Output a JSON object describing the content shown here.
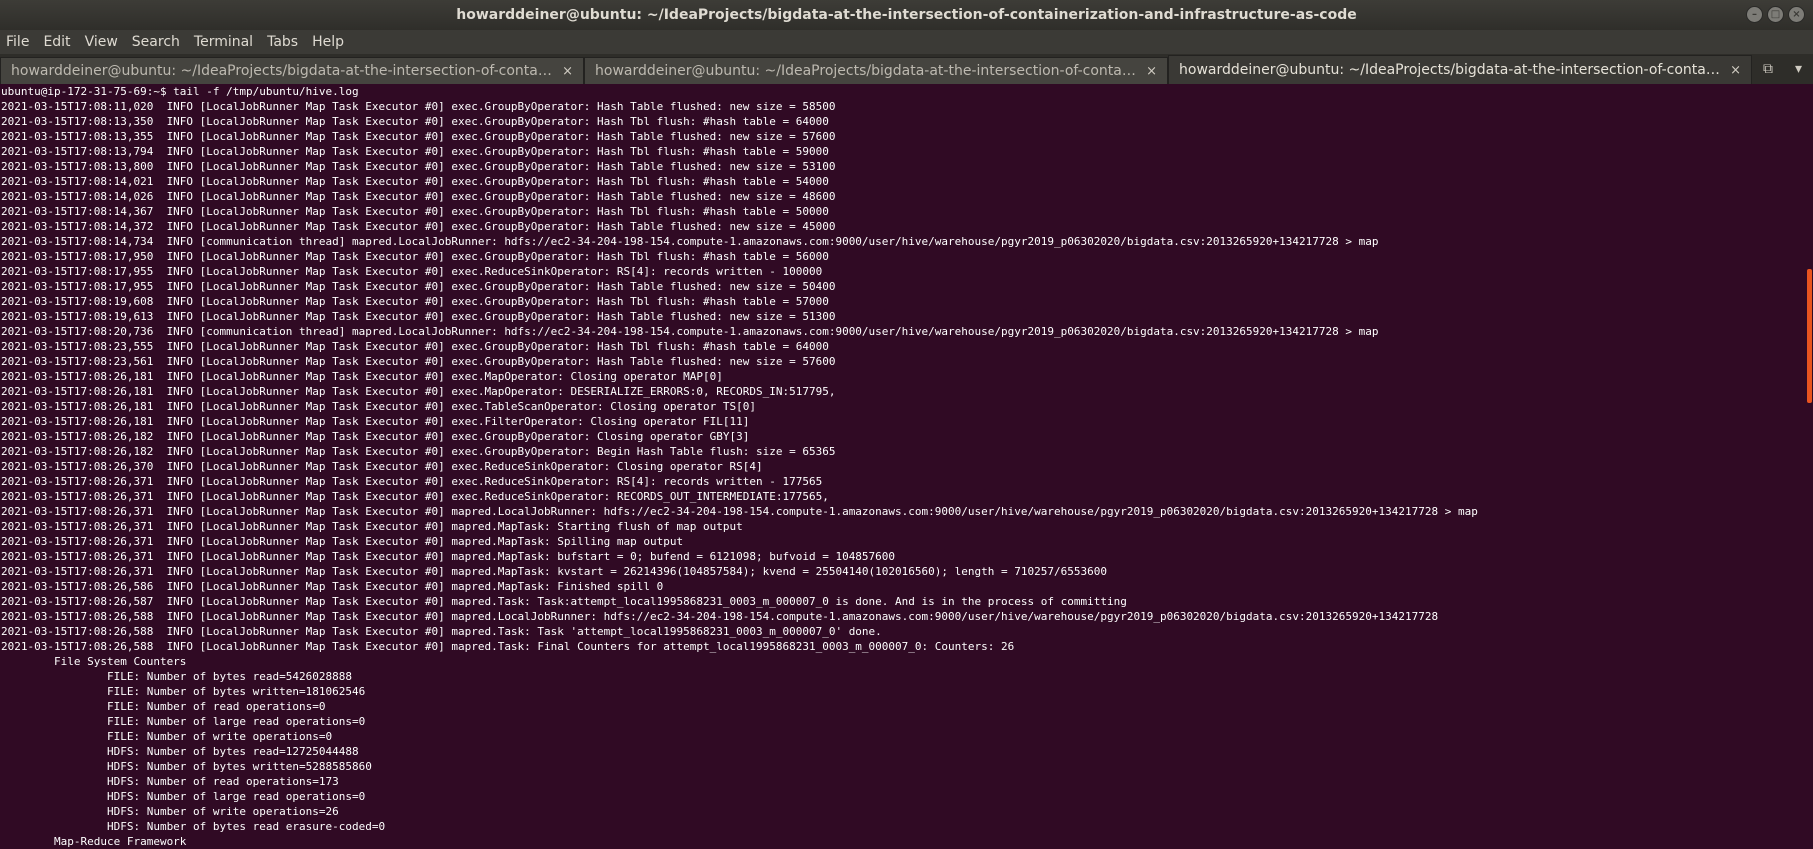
{
  "window": {
    "title": "howarddeiner@ubuntu: ~/IdeaProjects/bigdata-at-the-intersection-of-containerization-and-infrastructure-as-code",
    "controls": {
      "minimize": "–",
      "maximize": "□",
      "close": "×"
    }
  },
  "menu": {
    "file": "File",
    "edit": "Edit",
    "view": "View",
    "search": "Search",
    "terminal": "Terminal",
    "tabs": "Tabs",
    "help": "Help"
  },
  "tabs": [
    {
      "label": "howarddeiner@ubuntu: ~/IdeaProjects/bigdata-at-the-intersection-of-containe...",
      "close": "×"
    },
    {
      "label": "howarddeiner@ubuntu: ~/IdeaProjects/bigdata-at-the-intersection-of-containe...",
      "close": "×"
    },
    {
      "label": "howarddeiner@ubuntu: ~/IdeaProjects/bigdata-at-the-intersection-of-containe...",
      "close": "×"
    }
  ],
  "tab_tools": {
    "new_tab_icon": "⧉",
    "dropdown_icon": "▾"
  },
  "terminal": {
    "lines": [
      "ubuntu@ip-172-31-75-69:~$ tail -f /tmp/ubuntu/hive.log",
      "2021-03-15T17:08:11,020  INFO [LocalJobRunner Map Task Executor #0] exec.GroupByOperator: Hash Table flushed: new size = 58500",
      "2021-03-15T17:08:13,350  INFO [LocalJobRunner Map Task Executor #0] exec.GroupByOperator: Hash Tbl flush: #hash table = 64000",
      "2021-03-15T17:08:13,355  INFO [LocalJobRunner Map Task Executor #0] exec.GroupByOperator: Hash Table flushed: new size = 57600",
      "2021-03-15T17:08:13,794  INFO [LocalJobRunner Map Task Executor #0] exec.GroupByOperator: Hash Tbl flush: #hash table = 59000",
      "2021-03-15T17:08:13,800  INFO [LocalJobRunner Map Task Executor #0] exec.GroupByOperator: Hash Table flushed: new size = 53100",
      "2021-03-15T17:08:14,021  INFO [LocalJobRunner Map Task Executor #0] exec.GroupByOperator: Hash Tbl flush: #hash table = 54000",
      "2021-03-15T17:08:14,026  INFO [LocalJobRunner Map Task Executor #0] exec.GroupByOperator: Hash Table flushed: new size = 48600",
      "2021-03-15T17:08:14,367  INFO [LocalJobRunner Map Task Executor #0] exec.GroupByOperator: Hash Tbl flush: #hash table = 50000",
      "2021-03-15T17:08:14,372  INFO [LocalJobRunner Map Task Executor #0] exec.GroupByOperator: Hash Table flushed: new size = 45000",
      "2021-03-15T17:08:14,734  INFO [communication thread] mapred.LocalJobRunner: hdfs://ec2-34-204-198-154.compute-1.amazonaws.com:9000/user/hive/warehouse/pgyr2019_p06302020/bigdata.csv:2013265920+134217728 > map",
      "2021-03-15T17:08:17,950  INFO [LocalJobRunner Map Task Executor #0] exec.GroupByOperator: Hash Tbl flush: #hash table = 56000",
      "2021-03-15T17:08:17,955  INFO [LocalJobRunner Map Task Executor #0] exec.ReduceSinkOperator: RS[4]: records written - 100000",
      "2021-03-15T17:08:17,955  INFO [LocalJobRunner Map Task Executor #0] exec.GroupByOperator: Hash Table flushed: new size = 50400",
      "2021-03-15T17:08:19,608  INFO [LocalJobRunner Map Task Executor #0] exec.GroupByOperator: Hash Tbl flush: #hash table = 57000",
      "2021-03-15T17:08:19,613  INFO [LocalJobRunner Map Task Executor #0] exec.GroupByOperator: Hash Table flushed: new size = 51300",
      "2021-03-15T17:08:20,736  INFO [communication thread] mapred.LocalJobRunner: hdfs://ec2-34-204-198-154.compute-1.amazonaws.com:9000/user/hive/warehouse/pgyr2019_p06302020/bigdata.csv:2013265920+134217728 > map",
      "2021-03-15T17:08:23,555  INFO [LocalJobRunner Map Task Executor #0] exec.GroupByOperator: Hash Tbl flush: #hash table = 64000",
      "2021-03-15T17:08:23,561  INFO [LocalJobRunner Map Task Executor #0] exec.GroupByOperator: Hash Table flushed: new size = 57600",
      "2021-03-15T17:08:26,181  INFO [LocalJobRunner Map Task Executor #0] exec.MapOperator: Closing operator MAP[0]",
      "2021-03-15T17:08:26,181  INFO [LocalJobRunner Map Task Executor #0] exec.MapOperator: DESERIALIZE_ERRORS:0, RECORDS_IN:517795,",
      "2021-03-15T17:08:26,181  INFO [LocalJobRunner Map Task Executor #0] exec.TableScanOperator: Closing operator TS[0]",
      "2021-03-15T17:08:26,181  INFO [LocalJobRunner Map Task Executor #0] exec.FilterOperator: Closing operator FIL[11]",
      "2021-03-15T17:08:26,182  INFO [LocalJobRunner Map Task Executor #0] exec.GroupByOperator: Closing operator GBY[3]",
      "2021-03-15T17:08:26,182  INFO [LocalJobRunner Map Task Executor #0] exec.GroupByOperator: Begin Hash Table flush: size = 65365",
      "2021-03-15T17:08:26,370  INFO [LocalJobRunner Map Task Executor #0] exec.ReduceSinkOperator: Closing operator RS[4]",
      "2021-03-15T17:08:26,371  INFO [LocalJobRunner Map Task Executor #0] exec.ReduceSinkOperator: RS[4]: records written - 177565",
      "2021-03-15T17:08:26,371  INFO [LocalJobRunner Map Task Executor #0] exec.ReduceSinkOperator: RECORDS_OUT_INTERMEDIATE:177565,",
      "2021-03-15T17:08:26,371  INFO [LocalJobRunner Map Task Executor #0] mapred.LocalJobRunner: hdfs://ec2-34-204-198-154.compute-1.amazonaws.com:9000/user/hive/warehouse/pgyr2019_p06302020/bigdata.csv:2013265920+134217728 > map",
      "2021-03-15T17:08:26,371  INFO [LocalJobRunner Map Task Executor #0] mapred.MapTask: Starting flush of map output",
      "2021-03-15T17:08:26,371  INFO [LocalJobRunner Map Task Executor #0] mapred.MapTask: Spilling map output",
      "2021-03-15T17:08:26,371  INFO [LocalJobRunner Map Task Executor #0] mapred.MapTask: bufstart = 0; bufend = 6121098; bufvoid = 104857600",
      "2021-03-15T17:08:26,371  INFO [LocalJobRunner Map Task Executor #0] mapred.MapTask: kvstart = 26214396(104857584); kvend = 25504140(102016560); length = 710257/6553600",
      "2021-03-15T17:08:26,586  INFO [LocalJobRunner Map Task Executor #0] mapred.MapTask: Finished spill 0",
      "2021-03-15T17:08:26,587  INFO [LocalJobRunner Map Task Executor #0] mapred.Task: Task:attempt_local1995868231_0003_m_000007_0 is done. And is in the process of committing",
      "2021-03-15T17:08:26,588  INFO [LocalJobRunner Map Task Executor #0] mapred.LocalJobRunner: hdfs://ec2-34-204-198-154.compute-1.amazonaws.com:9000/user/hive/warehouse/pgyr2019_p06302020/bigdata.csv:2013265920+134217728",
      "2021-03-15T17:08:26,588  INFO [LocalJobRunner Map Task Executor #0] mapred.Task: Task 'attempt_local1995868231_0003_m_000007_0' done.",
      "2021-03-15T17:08:26,588  INFO [LocalJobRunner Map Task Executor #0] mapred.Task: Final Counters for attempt_local1995868231_0003_m_000007_0: Counters: 26",
      "        File System Counters",
      "                FILE: Number of bytes read=5426028888",
      "                FILE: Number of bytes written=181062546",
      "                FILE: Number of read operations=0",
      "                FILE: Number of large read operations=0",
      "                FILE: Number of write operations=0",
      "                HDFS: Number of bytes read=12725044488",
      "                HDFS: Number of bytes written=5288585860",
      "                HDFS: Number of read operations=173",
      "                HDFS: Number of large read operations=0",
      "                HDFS: Number of write operations=26",
      "                HDFS: Number of bytes read erasure-coded=0",
      "        Map-Reduce Framework"
    ]
  },
  "colors": {
    "terminal_bg": "#300a24",
    "terminal_fg": "#ffffff",
    "titlebar_bg": "#3b3a36",
    "accent": "#e95420"
  }
}
